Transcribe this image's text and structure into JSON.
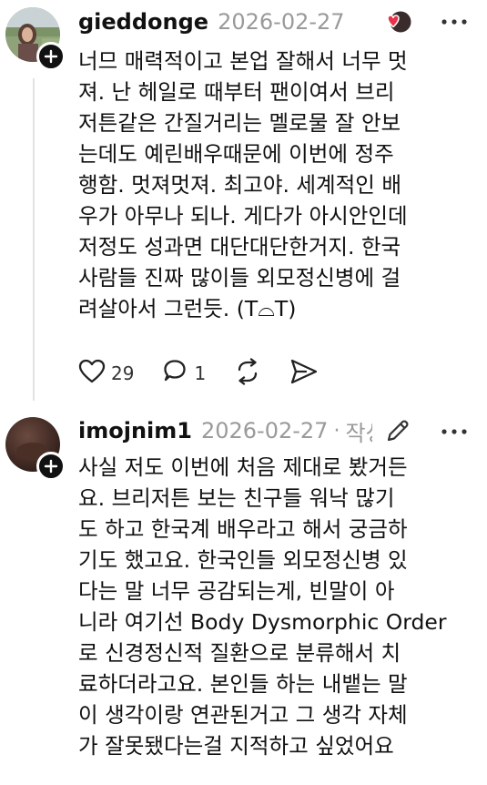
{
  "comments": [
    {
      "username": "gieddonge",
      "timestamp": "2026-02-27",
      "lines": [
        "너므 매력적이고 본업 잘해서 너무 멋",
        "져. 난 헤일로 때부터 팬이여서 브리",
        "저튼같은 간질거리는 멜로물 잘 안보",
        "는데도 예린배우때문에 이번에 정주",
        "행함. 멋져멋져. 최고야. 세계적인 배",
        "우가 아무나 되나. 게다가 아시안인데",
        "저정도 성과면 대단대단한거지. 한국",
        "사람들 진짜 많이들 외모정신병에 걸",
        "려살아서 그런듯. (T⌓T)"
      ],
      "likes": "29",
      "replies": "1"
    },
    {
      "username": "imojnim1",
      "timestamp": "2026-02-27",
      "separator": "·",
      "author_tag": "작성자",
      "lines": [
        "사실 저도 이번에 처음 제대로 봤거든",
        "요. 브리저튼 보는 친구들 워낙 많기",
        "도 하고 한국계 배우라고 해서 궁금하",
        "기도 했고요. 한국인들 외모정신병 있",
        "다는 말 너무 공감되는게, 빈말이 아",
        "니라 여기선 Body Dysmorphic Order",
        "로 신경정신적 질환으로 분류해서 치",
        "료하더라고요. 본인들 하는 내뱉는 말",
        "이 생각이랑 연관된거고 그 생각 자체",
        "가 잘못됐다는걸 지적하고 싶었어요"
      ]
    }
  ],
  "icons": {
    "more": "more-icon",
    "heart": "heart-icon",
    "reply": "reply-icon",
    "repost": "repost-icon",
    "share": "share-icon",
    "edit": "edit-icon",
    "follow": "follow-plus-icon"
  },
  "colors": {
    "like_reaction": "#e8334a",
    "muted_text": "#9a9a9a",
    "text": "#111111"
  }
}
